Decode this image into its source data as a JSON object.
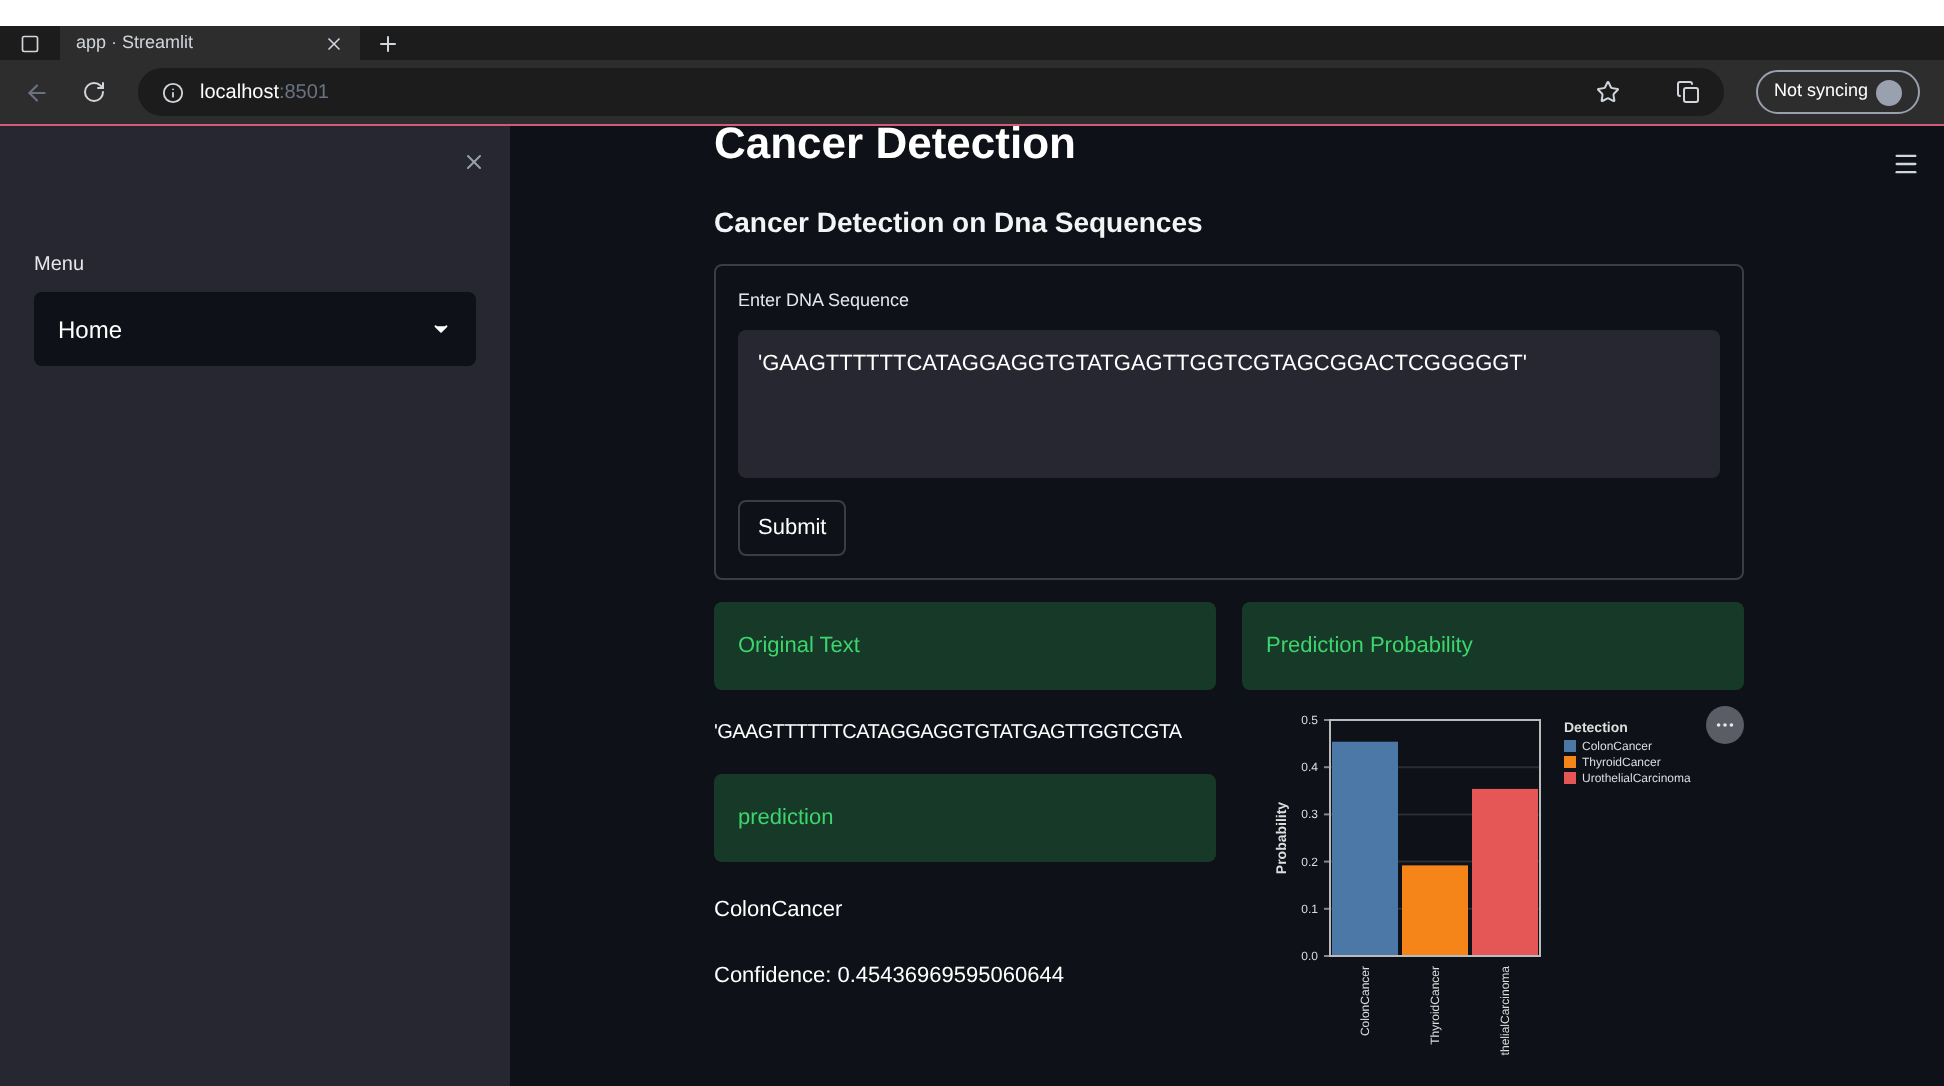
{
  "browser": {
    "tab_title": "app · Streamlit",
    "address_host": "localhost",
    "address_port": ":8501",
    "profile_label": "Not syncing"
  },
  "sidebar": {
    "menu_label": "Menu",
    "select_value": "Home"
  },
  "main": {
    "title": "Cancer Detection",
    "subtitle": "Cancer Detection on Dna Sequences",
    "form": {
      "field_label": "Enter DNA Sequence",
      "field_value": "'GAAGTTTTTTCATAGGAGGTGTATGAGTTGGTCGTAGCGGACTCGGGGGT'",
      "submit_label": "Submit"
    },
    "original_header": "Original Text",
    "original_text": "'GAAGTTTTTTCATAGGAGGTGTATGAGTTGGTCGTA",
    "prediction_header": "prediction",
    "prediction_text": "ColonCancer",
    "confidence_text": "Confidence: 0.45436969595060644",
    "probability_header": "Prediction Probability",
    "chart_data": {
      "type": "bar",
      "ylabel": "Probability",
      "categories": [
        "ColonCancer",
        "ThyroidCancer",
        "thelialCarcinoma"
      ],
      "ylim": [
        0,
        0.5
      ],
      "yticks": [
        {
          "value": 0,
          "label": "0.0"
        },
        {
          "value": 0.1,
          "label": "0.1"
        },
        {
          "value": 0.2,
          "label": "0.2"
        },
        {
          "value": 0.3,
          "label": "0.3"
        },
        {
          "value": 0.4,
          "label": "0.4"
        },
        {
          "value": 0.5,
          "label": "0.5"
        }
      ],
      "grid": true,
      "legend": {
        "title": "Detection"
      },
      "series": [
        {
          "name": "ColonCancer",
          "color": "#4c78a8",
          "values": [
            0.454,
            null,
            null
          ]
        },
        {
          "name": "ThyroidCancer",
          "color": "#f58518",
          "values": [
            null,
            0.192,
            null
          ]
        },
        {
          "name": "UrothelialCarcinoma",
          "color": "#e45756",
          "values": [
            null,
            null,
            0.354
          ]
        }
      ]
    }
  }
}
